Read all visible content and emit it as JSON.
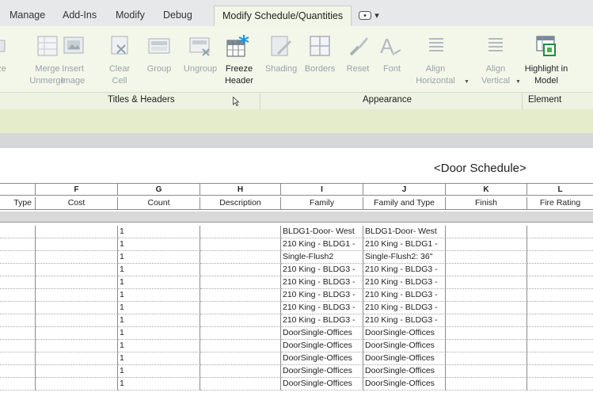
{
  "ribbon_tabs": [
    {
      "label": "Manage",
      "active": false
    },
    {
      "label": "Add-Ins",
      "active": false
    },
    {
      "label": "Modify",
      "active": false
    },
    {
      "label": "Debug",
      "active": false
    },
    {
      "label": "Modify Schedule/Quantities",
      "active": true
    }
  ],
  "tab_extra": {
    "caret": "▾"
  },
  "ribbon_buttons": [
    {
      "label": "ze",
      "enabled": false
    },
    {
      "label": "Merge Unmerge",
      "enabled": false
    },
    {
      "label": "Insert Image",
      "enabled": false
    },
    {
      "label": "Clear Cell",
      "enabled": false
    },
    {
      "label": "Group",
      "enabled": false
    },
    {
      "label": "Ungroup",
      "enabled": false
    },
    {
      "label": "Freeze Header",
      "enabled": true
    },
    {
      "label": "Shading",
      "enabled": false
    },
    {
      "label": "Borders",
      "enabled": false
    },
    {
      "label": "Reset",
      "enabled": false
    },
    {
      "label": "Font",
      "enabled": false
    },
    {
      "label": "Align Horizontal",
      "enabled": false
    },
    {
      "label": "Align Vertical",
      "enabled": false
    },
    {
      "label": "Highlight in Model",
      "enabled": true
    }
  ],
  "panels": [
    "Titles & Headers",
    "Appearance",
    "Element"
  ],
  "schedule": {
    "title": "<Door Schedule>",
    "column_letters": [
      "",
      "F",
      "G",
      "H",
      "I",
      "J",
      "K",
      "L"
    ],
    "column_headers": [
      "Type",
      "Cost",
      "Count",
      "Description",
      "Family",
      "Family and Type",
      "Finish",
      "Fire Rating"
    ],
    "rows": [
      [
        "",
        "",
        "1",
        "",
        "BLDG1-Door- West",
        "BLDG1-Door- West",
        "",
        ""
      ],
      [
        "",
        "",
        "1",
        "",
        "210 King - BLDG1 -",
        "210 King - BLDG1 -",
        "",
        ""
      ],
      [
        "",
        "",
        "1",
        "",
        "Single-Flush2",
        "Single-Flush2: 36\"",
        "",
        ""
      ],
      [
        "",
        "",
        "1",
        "",
        "210 King - BLDG3 -",
        "210 King - BLDG3 -",
        "",
        ""
      ],
      [
        "",
        "",
        "1",
        "",
        "210 King - BLDG3 -",
        "210 King - BLDG3 -",
        "",
        ""
      ],
      [
        "",
        "",
        "1",
        "",
        "210 King - BLDG3 -",
        "210 King - BLDG3 -",
        "",
        ""
      ],
      [
        "",
        "",
        "1",
        "",
        "210 King - BLDG3 -",
        "210 King - BLDG3 -",
        "",
        ""
      ],
      [
        "",
        "",
        "1",
        "",
        "210 King - BLDG3 -",
        "210 King - BLDG3 -",
        "",
        ""
      ],
      [
        "",
        "",
        "1",
        "",
        "DoorSingle-Offices",
        "DoorSingle-Offices",
        "",
        ""
      ],
      [
        "",
        "",
        "1",
        "",
        "DoorSingle-Offices",
        "DoorSingle-Offices",
        "",
        ""
      ],
      [
        "",
        "",
        "1",
        "",
        "DoorSingle-Offices",
        "DoorSingle-Offices",
        "",
        ""
      ],
      [
        "",
        "",
        "1",
        "",
        "DoorSingle-Offices",
        "DoorSingle-Offices",
        "",
        ""
      ],
      [
        "",
        "",
        "1",
        "",
        "DoorSingle-Offices",
        "DoorSingle-Offices",
        "",
        ""
      ]
    ]
  }
}
